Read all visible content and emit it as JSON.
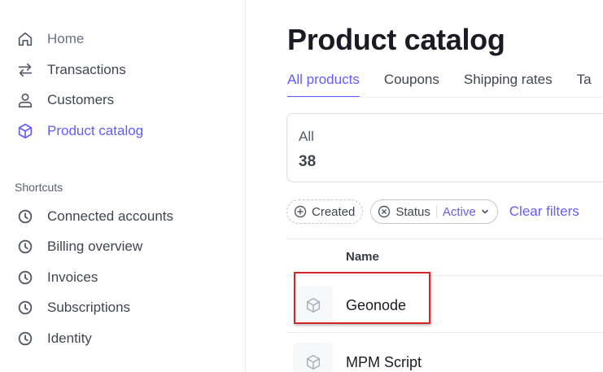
{
  "sidebar": {
    "items": [
      {
        "label": "Home",
        "icon": "home-icon"
      },
      {
        "label": "Transactions",
        "icon": "arrows-swap-icon"
      },
      {
        "label": "Customers",
        "icon": "person-icon"
      },
      {
        "label": "Product catalog",
        "icon": "box-icon"
      }
    ],
    "shortcuts_heading": "Shortcuts",
    "shortcuts": [
      {
        "label": "Connected accounts",
        "icon": "clock-icon"
      },
      {
        "label": "Billing overview",
        "icon": "clock-icon"
      },
      {
        "label": "Invoices",
        "icon": "clock-icon"
      },
      {
        "label": "Subscriptions",
        "icon": "clock-icon"
      },
      {
        "label": "Identity",
        "icon": "clock-icon"
      }
    ]
  },
  "main": {
    "title": "Product catalog",
    "tabs": [
      {
        "label": "All products"
      },
      {
        "label": "Coupons"
      },
      {
        "label": "Shipping rates"
      },
      {
        "label": "Ta"
      }
    ],
    "count_card": {
      "label": "All",
      "value": "38"
    },
    "filters": {
      "created_label": "Created",
      "status_label": "Status",
      "status_value": "Active",
      "clear_label": "Clear filters"
    },
    "table": {
      "column_name": "Name",
      "rows": [
        {
          "name": "Geonode",
          "icon": "box-icon"
        },
        {
          "name": "MPM Script",
          "icon": "box-icon"
        }
      ]
    }
  },
  "colors": {
    "accent": "#635bff",
    "highlight": "#d0262b",
    "text": "#414552",
    "border": "#d8dee4"
  }
}
